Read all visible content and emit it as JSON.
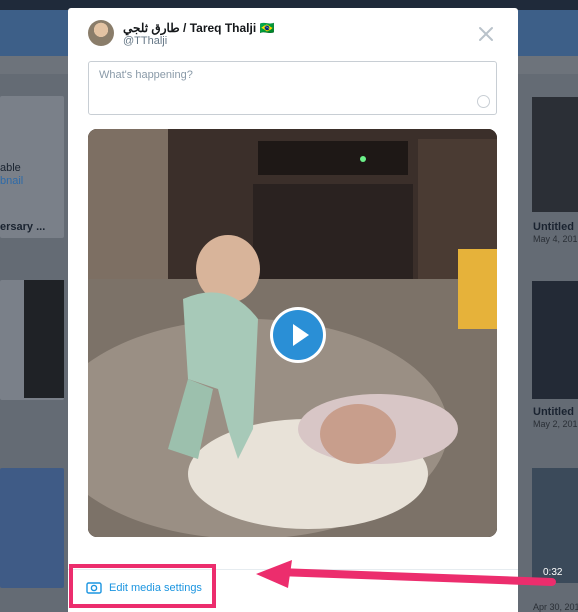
{
  "background": {
    "left_column": [
      {
        "text": "able"
      },
      {
        "text": "bnail"
      },
      {
        "text": "ersary ..."
      }
    ],
    "right_column": [
      {
        "title": "Untitled",
        "date": "May 4, 201"
      },
      {
        "title": "Untitled",
        "date": "May 2, 201"
      },
      {
        "duration": "0:32",
        "date": "Apr 30, 201"
      }
    ]
  },
  "modal": {
    "user": {
      "name": "طارق ثلجي / Tareq Thalji 🇧🇷",
      "handle": "@TThalji"
    },
    "compose": {
      "placeholder": "What's happening?"
    },
    "edit_media_label": "Edit media settings"
  },
  "colors": {
    "accent": "#1b95e0",
    "annotation": "#ec2d6d",
    "play_button": "#2a8fd6"
  }
}
